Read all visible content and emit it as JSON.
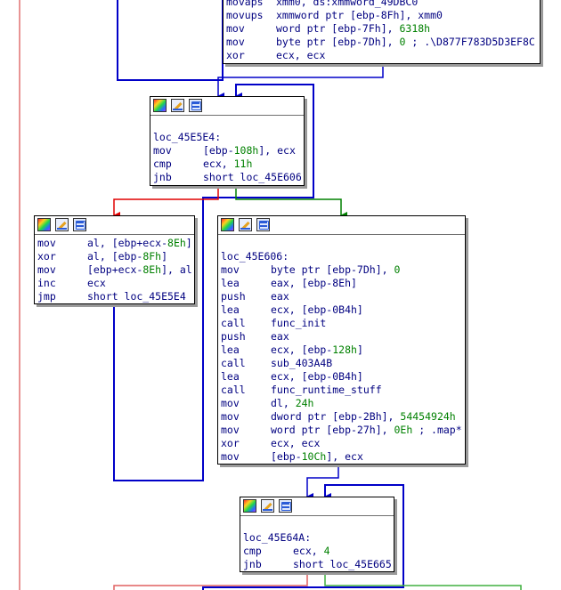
{
  "colors": {
    "background": "#ffffff",
    "instruction": "#000080",
    "number": "#008000",
    "edge_true": "#008000",
    "edge_false": "#e00000",
    "edge_jump": "#0000c8",
    "edge_back": "#e06060"
  },
  "header_icons": [
    "color-palette-icon",
    "edit-node-icon",
    "graph-overview-icon"
  ],
  "blocks": {
    "top": {
      "label": "",
      "lines": [
        {
          "mn": "movaps",
          "ops": [
            {
              "t": "xmm0, ds:xmmword_49DBC0",
              "num": false
            }
          ]
        },
        {
          "mn": "movups",
          "ops": [
            {
              "t": "xmmword ptr [ebp-8Fh], xmm0",
              "num": false
            }
          ]
        },
        {
          "mn": "mov",
          "ops": [
            {
              "t": "word ptr [ebp-7Fh], ",
              "num": false
            },
            {
              "t": "6318h",
              "num": true
            }
          ]
        },
        {
          "mn": "mov",
          "ops": [
            {
              "t": "byte ptr [ebp-7Dh], ",
              "num": false
            },
            {
              "t": "0",
              "num": true
            },
            {
              "t": " ; .\\D877F783D5D3EF8C",
              "num": false
            }
          ]
        },
        {
          "mn": "xor",
          "ops": [
            {
              "t": "ecx, ecx",
              "num": false
            }
          ]
        }
      ]
    },
    "loc1": {
      "label": "loc_45E5E4:",
      "lines": [
        {
          "mn": "mov",
          "ops": [
            {
              "t": "[ebp-",
              "num": false
            },
            {
              "t": "108h",
              "num": true
            },
            {
              "t": "], ecx",
              "num": false
            }
          ]
        },
        {
          "mn": "cmp",
          "ops": [
            {
              "t": "ecx, ",
              "num": false
            },
            {
              "t": "11h",
              "num": true
            }
          ]
        },
        {
          "mn": "jnb",
          "ops": [
            {
              "t": "short loc_45E606",
              "num": false
            }
          ]
        }
      ]
    },
    "loop": {
      "label": "",
      "lines": [
        {
          "mn": "mov",
          "ops": [
            {
              "t": "al, [ebp+ecx-",
              "num": false
            },
            {
              "t": "8Eh",
              "num": true
            },
            {
              "t": "]",
              "num": false
            }
          ]
        },
        {
          "mn": "xor",
          "ops": [
            {
              "t": "al, [ebp-",
              "num": false
            },
            {
              "t": "8Fh",
              "num": true
            },
            {
              "t": "]",
              "num": false
            }
          ]
        },
        {
          "mn": "mov",
          "ops": [
            {
              "t": "[ebp+ecx-",
              "num": false
            },
            {
              "t": "8Eh",
              "num": true
            },
            {
              "t": "], al",
              "num": false
            }
          ]
        },
        {
          "mn": "inc",
          "ops": [
            {
              "t": "ecx",
              "num": false
            }
          ]
        },
        {
          "mn": "jmp",
          "ops": [
            {
              "t": "short loc_45E5E4",
              "num": false
            }
          ]
        }
      ]
    },
    "loc2": {
      "label": "loc_45E606:",
      "lines": [
        {
          "mn": "mov",
          "ops": [
            {
              "t": "byte ptr [ebp-7Dh], ",
              "num": false
            },
            {
              "t": "0",
              "num": true
            }
          ]
        },
        {
          "mn": "lea",
          "ops": [
            {
              "t": "eax, [ebp-8Eh]",
              "num": false
            }
          ]
        },
        {
          "mn": "push",
          "ops": [
            {
              "t": "eax",
              "num": false
            }
          ]
        },
        {
          "mn": "lea",
          "ops": [
            {
              "t": "ecx, [ebp-0B4h]",
              "num": false
            }
          ]
        },
        {
          "mn": "call",
          "ops": [
            {
              "t": "func_init",
              "num": false
            }
          ]
        },
        {
          "mn": "push",
          "ops": [
            {
              "t": "eax",
              "num": false
            }
          ]
        },
        {
          "mn": "lea",
          "ops": [
            {
              "t": "ecx, [ebp-",
              "num": false
            },
            {
              "t": "128h",
              "num": true
            },
            {
              "t": "]",
              "num": false
            }
          ]
        },
        {
          "mn": "call",
          "ops": [
            {
              "t": "sub_403A4B",
              "num": false
            }
          ]
        },
        {
          "mn": "lea",
          "ops": [
            {
              "t": "ecx, [ebp-0B4h]",
              "num": false
            }
          ]
        },
        {
          "mn": "call",
          "ops": [
            {
              "t": "func_runtime_stuff",
              "num": false
            }
          ]
        },
        {
          "mn": "mov",
          "ops": [
            {
              "t": "dl, ",
              "num": false
            },
            {
              "t": "24h",
              "num": true
            }
          ]
        },
        {
          "mn": "mov",
          "ops": [
            {
              "t": "dword ptr [ebp-2Bh], ",
              "num": false
            },
            {
              "t": "54454924h",
              "num": true
            }
          ]
        },
        {
          "mn": "mov",
          "ops": [
            {
              "t": "word ptr [ebp-27h], ",
              "num": false
            },
            {
              "t": "0Eh",
              "num": true
            },
            {
              "t": " ; .map*",
              "num": false
            }
          ]
        },
        {
          "mn": "xor",
          "ops": [
            {
              "t": "ecx, ecx",
              "num": false
            }
          ]
        },
        {
          "mn": "mov",
          "ops": [
            {
              "t": "[ebp-",
              "num": false
            },
            {
              "t": "10Ch",
              "num": true
            },
            {
              "t": "], ecx",
              "num": false
            }
          ]
        }
      ]
    },
    "loc3": {
      "label": "loc_45E64A:",
      "lines": [
        {
          "mn": "cmp",
          "ops": [
            {
              "t": "ecx, ",
              "num": false
            },
            {
              "t": "4",
              "num": true
            }
          ]
        },
        {
          "mn": "jnb",
          "ops": [
            {
              "t": "short loc_45E665",
              "num": false
            }
          ]
        }
      ]
    }
  }
}
